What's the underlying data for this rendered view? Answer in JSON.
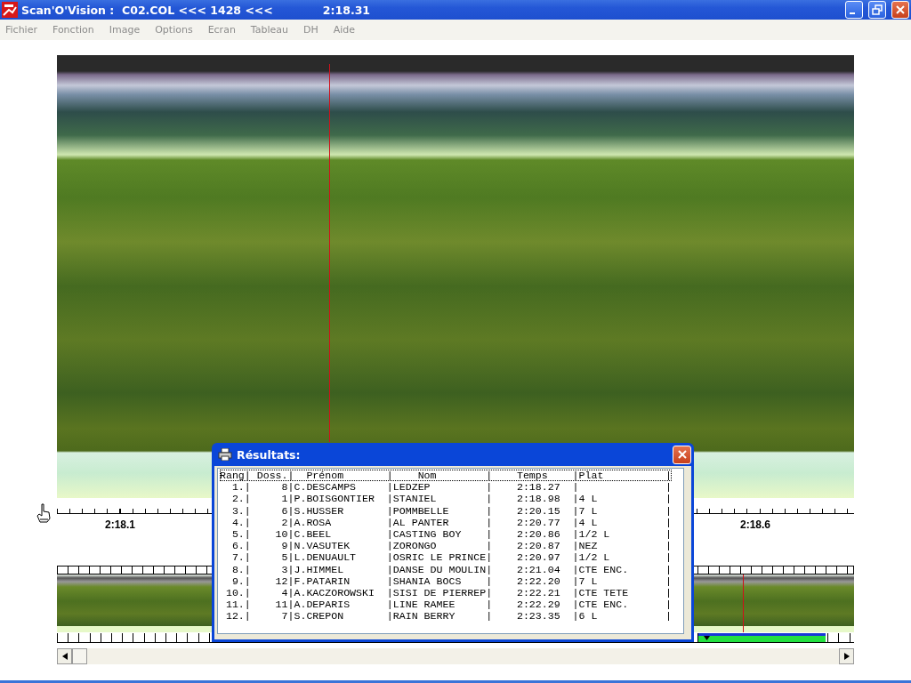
{
  "window": {
    "title": "Scan'O'Vision :  C02.COL <<< 1428 <<<",
    "time": "2:18.31"
  },
  "menu": [
    "Fichier",
    "Fonction",
    "Image",
    "Options",
    "Ecran",
    "Tableau",
    "DH",
    "Aide"
  ],
  "timeline": {
    "labels": [
      "2:18.1",
      "2:18.6"
    ]
  },
  "results_dialog": {
    "title": "Résultats:",
    "header": "Rang| Doss.|  Prénom       |    Nom        |    Temps    |Plat          |",
    "rows": [
      "  1.|     8|C.DESCAMPS     |LEDZEP         |    2:18.27  |              |",
      "  2.|     1|P.BOISGONTIER  |STANIEL        |    2:18.98  |4 L           |",
      "  3.|     6|S.HUSSER       |POMMBELLE      |    2:20.15  |7 L           |",
      "  4.|     2|A.ROSA         |AL PANTER      |    2:20.77  |4 L           |",
      "  5.|    10|C.BEEL         |CASTING BOY    |    2:20.86  |1/2 L         |",
      "  6.|     9|N.VASUTEK      |ZORONGO        |    2:20.87  |NEZ           |",
      "  7.|     5|L.DENUAULT     |OSRIC LE PRINCE|    2:20.97  |1/2 L         |",
      "  8.|     3|J.HIMMEL       |DANSE DU MOULIN|    2:21.04  |CTE ENC.      |",
      "  9.|    12|F.PATARIN      |SHANIA BOCS    |    2:22.20  |7 L           |",
      " 10.|     4|A.KACZOROWSKI  |SISI DE PIERREP|    2:22.21  |CTE TETE      |",
      " 11.|    11|A.DEPARIS      |LINE RAMEE     |    2:22.29  |CTE ENC.      |",
      " 12.|     7|S.CREPON       |RAIN BERRY     |    2:23.35  |6 L           |"
    ]
  }
}
